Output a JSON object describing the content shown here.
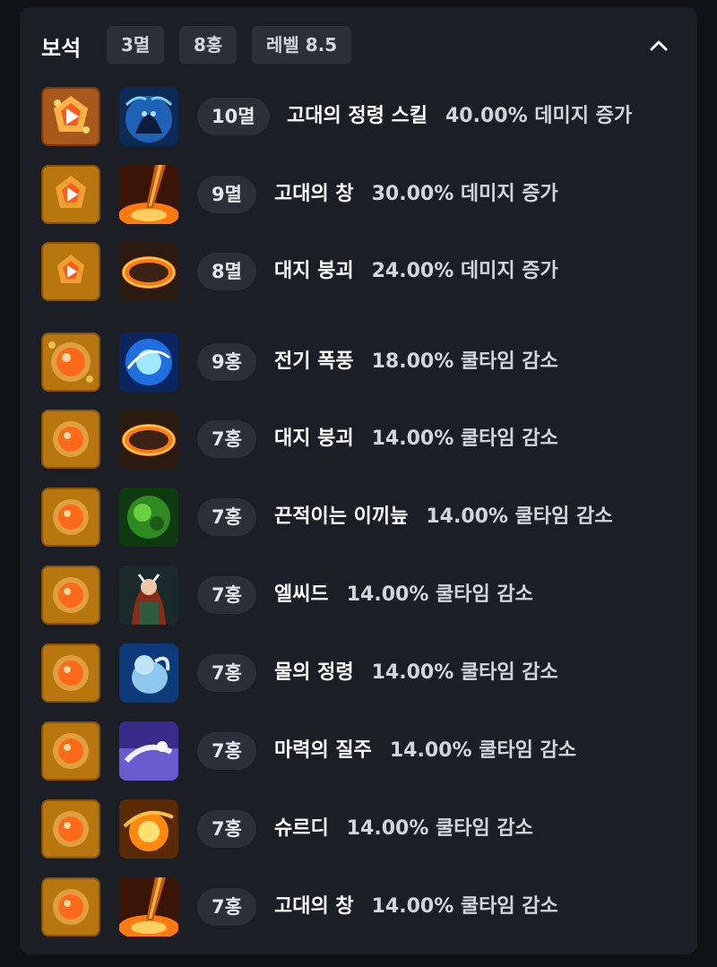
{
  "section": {
    "title": "보석",
    "summary_chips": [
      "3멸",
      "8홍",
      "레벨 8.5"
    ]
  },
  "gems": [
    {
      "tag": "10멸",
      "skill": "고대의 정령 스킬",
      "effect": "40.00% 데미지 증가",
      "gem_type": "damage",
      "skill_art": "ancient-spirit"
    },
    {
      "tag": "9멸",
      "skill": "고대의 창",
      "effect": "30.00% 데미지 증가",
      "gem_type": "damage",
      "skill_art": "ancient-spear"
    },
    {
      "tag": "8멸",
      "skill": "대지 붕괴",
      "effect": "24.00% 데미지 증가",
      "gem_type": "damage",
      "skill_art": "earth-collapse"
    },
    {
      "tag": "9홍",
      "skill": "전기 폭풍",
      "effect": "18.00% 쿨타임 감소",
      "gem_type": "cooldown",
      "skill_art": "electric-storm"
    },
    {
      "tag": "7홍",
      "skill": "대지 붕괴",
      "effect": "14.00% 쿨타임 감소",
      "gem_type": "cooldown",
      "skill_art": "earth-collapse"
    },
    {
      "tag": "7홍",
      "skill": "끈적이는 이끼늪",
      "effect": "14.00% 쿨타임 감소",
      "gem_type": "cooldown",
      "skill_art": "sticky-moss"
    },
    {
      "tag": "7홍",
      "skill": "엘씨드",
      "effect": "14.00% 쿨타임 감소",
      "gem_type": "cooldown",
      "skill_art": "elcid"
    },
    {
      "tag": "7홍",
      "skill": "물의 정령",
      "effect": "14.00% 쿨타임 감소",
      "gem_type": "cooldown",
      "skill_art": "water-spirit"
    },
    {
      "tag": "7홍",
      "skill": "마력의 질주",
      "effect": "14.00% 쿨타임 감소",
      "gem_type": "cooldown",
      "skill_art": "mana-rush"
    },
    {
      "tag": "7홍",
      "skill": "슈르디",
      "effect": "14.00% 쿨타임 감소",
      "gem_type": "cooldown",
      "skill_art": "shurdi"
    },
    {
      "tag": "7홍",
      "skill": "고대의 창",
      "effect": "14.00% 쿨타임 감소",
      "gem_type": "cooldown",
      "skill_art": "ancient-spear"
    }
  ],
  "colors": {
    "panel": "#1b1e24",
    "chip": "#2b2f37",
    "gem_frame": "#a8690f"
  }
}
